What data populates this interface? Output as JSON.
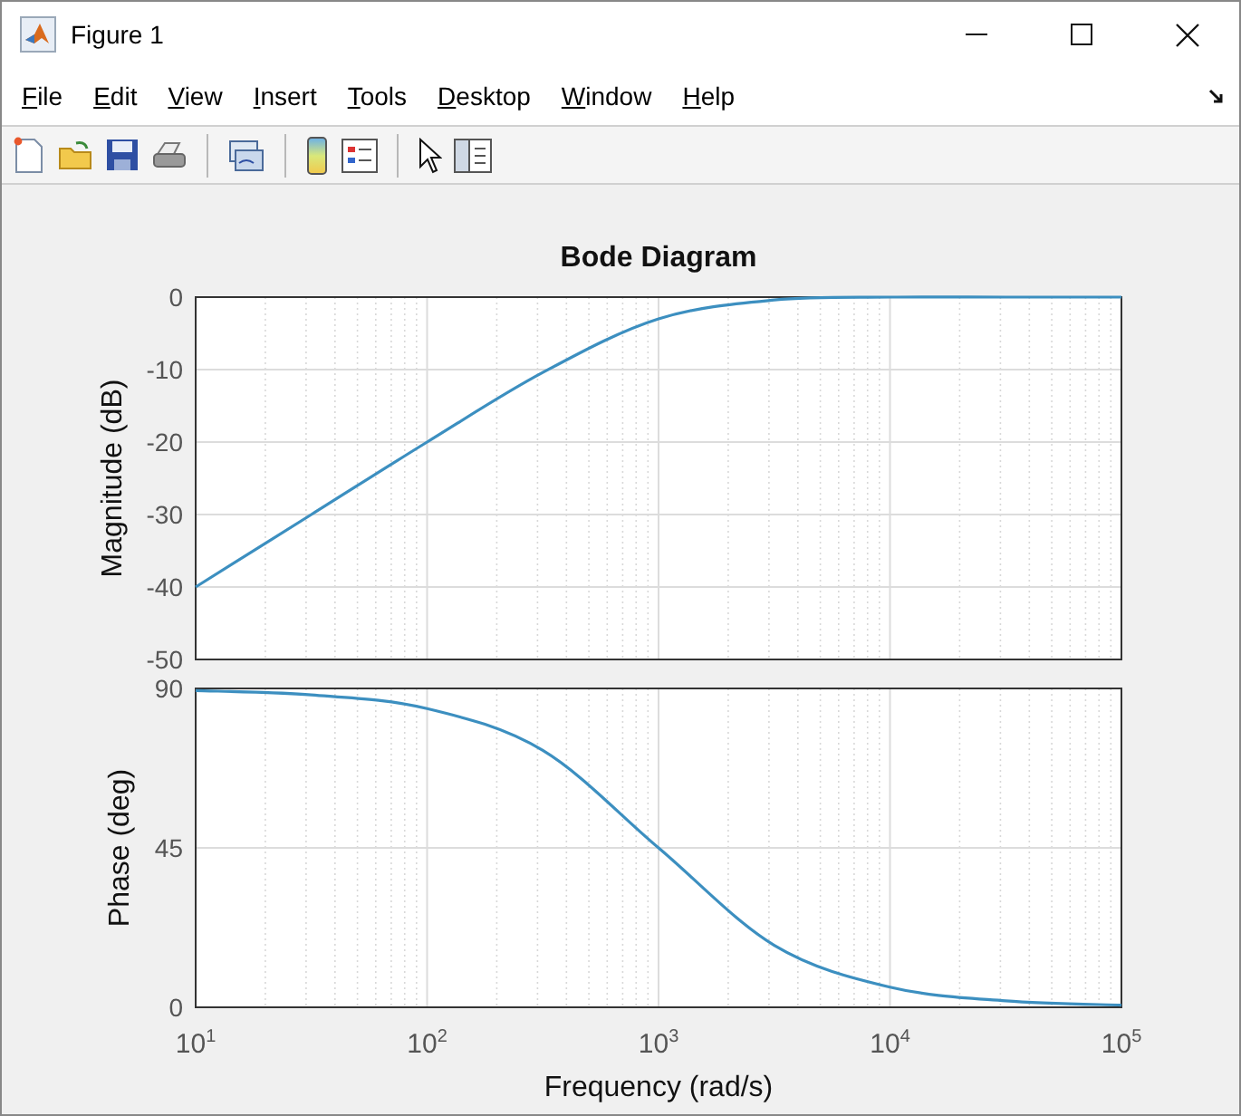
{
  "window": {
    "title": "Figure 1"
  },
  "menu": [
    "File",
    "Edit",
    "View",
    "Insert",
    "Tools",
    "Desktop",
    "Window",
    "Help"
  ],
  "figure": {
    "title": "Bode Diagram",
    "magnitude": {
      "chart_data": {
        "type": "line",
        "ylabel": "Magnitude (dB)",
        "series": [
          {
            "color": "#3c8fc0",
            "values": [
              -40,
              -30,
              -20,
              -10.4,
              -3,
              -0.4,
              0,
              0,
              0
            ]
          }
        ],
        "ylim": [
          -50,
          0
        ],
        "grid": true,
        "yticks": [
          {
            "value": 0,
            "label": "0"
          },
          {
            "value": -10,
            "label": "-10"
          },
          {
            "value": -20,
            "label": "-20"
          },
          {
            "value": -30,
            "label": "-30"
          },
          {
            "value": -40,
            "label": "-40"
          },
          {
            "value": -50,
            "label": "-50"
          }
        ]
      }
    },
    "phase": {
      "chart_data": {
        "type": "line",
        "xlabel": "Frequency  (rad/s)",
        "ylabel": "Phase (deg)",
        "categories": [
          "10$^{1}$",
          null,
          "10$^{2}$",
          null,
          "10$^{3}$",
          null,
          "10$^{4}$",
          null,
          "10$^{5}$"
        ],
        "series": [
          {
            "color": "#3c8fc0",
            "values": [
              89.4,
              88.2,
              84.3,
              72.5,
              45,
              17.5,
              5.7,
              1.8,
              0.6
            ]
          }
        ],
        "ylim": [
          0,
          90
        ],
        "grid": true,
        "yticks": [
          {
            "value": 90,
            "label": "90"
          },
          {
            "value": 45,
            "label": "45"
          },
          {
            "value": 0,
            "label": "0"
          }
        ]
      }
    }
  }
}
